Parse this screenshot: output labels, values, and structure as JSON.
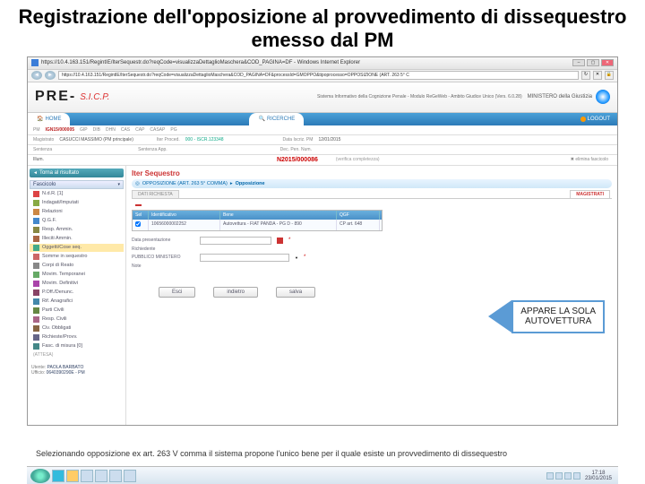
{
  "slide": {
    "title": "Registrazione dell'opposizione al provvedimento di dissequestro emesso dal PM",
    "footnote": "Selezionando opposizione ex art. 263 V comma il sistema propone l'unico bene per il quale esiste un provvedimento di dissequestro"
  },
  "window": {
    "title": "https://10.4.163.151/RegintIE/IterSequestr.do?reqCode=visualizzaDettaglioMaschera&COD_PAGINA=DF - Windows Internet Explorer",
    "url": "https://10.4.163.151/RegintIE/IterSequestr.do?reqCode=visualizzaDettaglioMaschera&COD_PAGINA=DF&processId=GMOPPO&tipoprocesso=OPPOSIZIONE (ART. 263 5° C"
  },
  "brand": {
    "pre": "PRE-",
    "sicp": "S.I.C.P.",
    "subtitle": "Sistema Informativo della Cognizione Penale - Modulo ReGeWeb - Ambito Giudice Unico (Vers. 6.0.28)",
    "ministry": "MINISTERO della Giustizia"
  },
  "tabs": {
    "home": "HOME",
    "ricerche": "RICERCHE",
    "logout": "LOGOUT"
  },
  "info": {
    "pm_lbl": "PM",
    "pm_val": "IGN15/000005",
    "gip_lbl": "GIP",
    "dib_lbl": "DIB",
    "dhn_lbl": "DHN",
    "cas_lbl": "CAS",
    "cap_lbl": "CAP",
    "casap_lbl": "CASAP",
    "pg_lbl": "PG",
    "mag_lbl": "Magistrato",
    "mag_val": "CASUCCI MASSIMO (PM principale)",
    "iter_lbl": "Iter Proced.",
    "iter_val": "000 - ISCR.123348",
    "data_lbl": "Data Iscriz. PM",
    "data_val": "12/01/2015",
    "sent_lbl": "Sentenza",
    "sentapp_lbl": "Sentenza App.",
    "illum_lbl": "Illum.",
    "decpen_lbl": "Dec. Pen. Num.",
    "case": "N2015/000086",
    "verif": "(verifica completezza)",
    "elim": "✖ elimina fascicolo",
    "attesa": "(ATTESA)"
  },
  "sidebar": {
    "back": "Torna al risultato",
    "fascicolo": "Fascicolo",
    "items": [
      {
        "ico": "#d44",
        "label": "N.d.R. [1]"
      },
      {
        "ico": "#8a4",
        "label": "Indagati/Imputati"
      },
      {
        "ico": "#c84",
        "label": "Relazioni"
      },
      {
        "ico": "#48c",
        "label": "Q.G.F."
      },
      {
        "ico": "#884",
        "label": "Resp. Ammin."
      },
      {
        "ico": "#a64",
        "label": "Illeciti Ammin."
      },
      {
        "ico": "#4a8",
        "label": "Oggetti/Cose seq."
      },
      {
        "ico": "#c66",
        "label": "Somme in sequestro"
      },
      {
        "ico": "#888",
        "label": "Corpi di Reato"
      },
      {
        "ico": "#6a6",
        "label": "Movim. Temporanei"
      },
      {
        "ico": "#a4a",
        "label": "Movim. Definitivi"
      },
      {
        "ico": "#846",
        "label": "P.Off./Denunc."
      },
      {
        "ico": "#48a",
        "label": "Rif. Anagrafici"
      },
      {
        "ico": "#684",
        "label": "Parti Civili"
      },
      {
        "ico": "#a68",
        "label": "Resp. Civili"
      },
      {
        "ico": "#864",
        "label": "Civ. Obbligati"
      },
      {
        "ico": "#668",
        "label": "Richieste/Provv."
      },
      {
        "ico": "#488",
        "label": "Fasc. di misura [0]"
      }
    ],
    "user_lbl": "Utente:",
    "user": "PAOLA BARBATO",
    "uff_lbl": "Ufficio:",
    "uff": "0640390290E - PM"
  },
  "content": {
    "iter": "Iter Sequestro",
    "crumb_a": "OPPOSIZIONE (ART. 263 5° COMMA)",
    "crumb_b": "Opposizione",
    "tab1": "DATI RICHIESTA",
    "tab2": "MAGISTRATI",
    "table": {
      "h1": "Sel",
      "h2": "Identificativo",
      "h3": "Bene",
      "h4": "QGF",
      "r_id": "10656000002252",
      "r_bene": "Autovettura - FIAT PANDA - PG  D - 890",
      "r_qgf": "CP art. 648"
    },
    "form": {
      "data_pres": "Data presentazione",
      "richied": "Richiedente",
      "pm": "PUBBLICO MINISTERO",
      "note": "Note"
    },
    "btns": {
      "esci": "Esci",
      "indietro": "indietro",
      "salva": "salva"
    }
  },
  "callout": {
    "l1": "APPARE LA SOLA",
    "l2": "AUTOVETTURA"
  },
  "taskbar": {
    "time": "17:18",
    "date": "23/01/2015"
  }
}
